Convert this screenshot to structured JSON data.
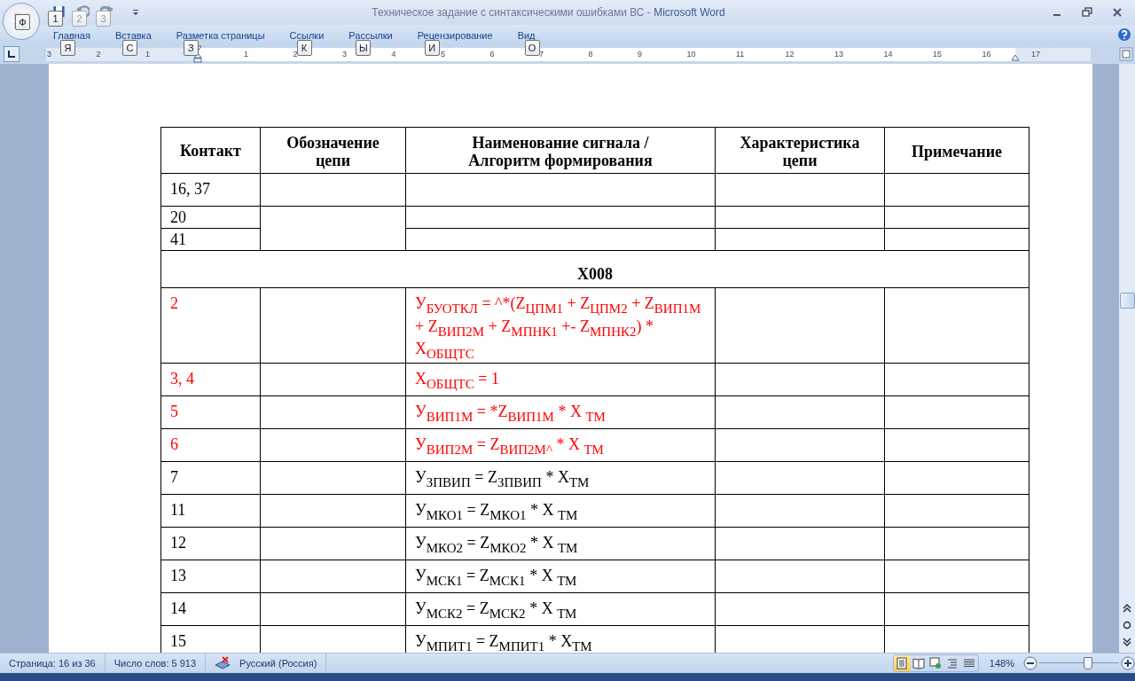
{
  "window": {
    "document": "Техническое задание с синтаксическими ошибками ВС",
    "separator": "-",
    "app": "Microsoft Word"
  },
  "office_button": {
    "keytip": "Ф"
  },
  "quick_access": [
    {
      "kind": "save",
      "keytip": "1",
      "disabled": false
    },
    {
      "kind": "undo",
      "keytip": "2",
      "disabled": true
    },
    {
      "kind": "redo",
      "keytip": "3",
      "disabled": true
    }
  ],
  "tabs": [
    {
      "label": "Главная",
      "keytip": "Я",
      "selected": false
    },
    {
      "label": "Вставка",
      "keytip": "С",
      "selected": false
    },
    {
      "label": "Разметка страницы",
      "keytip": "З",
      "selected": false
    },
    {
      "label": "Ссылки",
      "keytip": "К",
      "selected": false
    },
    {
      "label": "Рассылки",
      "keytip": "Ы",
      "selected": false
    },
    {
      "label": "Рецензирование",
      "keytip": "И",
      "selected": false
    },
    {
      "label": "Вид",
      "keytip": "О",
      "selected": false
    }
  ],
  "ruler": {
    "left_numbers": [
      "3",
      "2",
      "1"
    ],
    "right_numbers": [
      "1",
      "2",
      "3",
      "4",
      "5",
      "6",
      "7",
      "8",
      "9",
      "10",
      "11",
      "12",
      "13",
      "14",
      "15",
      "16",
      "17"
    ]
  },
  "table": {
    "columns": [
      "Контакт",
      "Обозначение цепи",
      "Наименование сигнала / Алгоритм формирования",
      "Характеристика цепи",
      "Примечание"
    ],
    "rows": [
      {
        "kind": "data",
        "contact": "16, 37",
        "error": false
      },
      {
        "kind": "merge-top",
        "contact": "20",
        "error": false
      },
      {
        "kind": "merge-bottom",
        "contact": "41",
        "error": false
      },
      {
        "kind": "section",
        "title": "X008"
      },
      {
        "kind": "data",
        "contact": "2",
        "signal": "У$_{БУОТКЛ}$ = ^*(Z$_{ЦПМ1}$ + Z$_{ЦПМ2}$ + Z$_{ВИП1М}$ + Z$_{ВИП2М}$ + Z$_{МПНК1}$ +- Z$_{МПНК2}$) * X$_{ОБЩТС}$",
        "error": true
      },
      {
        "kind": "data",
        "contact": "3, 4",
        "signal": "X$_{ОБЩТС}$ = 1",
        "error": true
      },
      {
        "kind": "data",
        "contact": "5",
        "signal": "У$_{ВИП1М}$ = *Z$_{ВИП1М}$ * X $_{ТМ}$",
        "error": true
      },
      {
        "kind": "data",
        "contact": "6",
        "signal": "У$_{ВИП2М}$ = Z$_{ВИП2М^}$ * X $_{ТМ}$",
        "error": true
      },
      {
        "kind": "data",
        "contact": "7",
        "signal": "У$_{ЗПВИП}$ = Z$_{ЗПВИП}$ * X$_{ТМ}$",
        "error": false
      },
      {
        "kind": "data",
        "contact": "11",
        "signal": "У$_{МКО1}$ = Z$_{МКО1}$ * X $_{ТМ}$",
        "error": false
      },
      {
        "kind": "data",
        "contact": "12",
        "signal": "У$_{МКО2}$ = Z$_{МКО2}$ * X $_{ТМ}$",
        "error": false
      },
      {
        "kind": "data",
        "contact": "13",
        "signal": "У$_{МСК1}$ = Z$_{МСК1}$ * X $_{ТМ}$",
        "error": false
      },
      {
        "kind": "data",
        "contact": "14",
        "signal": "У$_{МСК2}$ = Z$_{МСК2}$ * X $_{ТМ}$",
        "error": false
      },
      {
        "kind": "data",
        "contact": "15",
        "signal": "У$_{МПИТ1}$ = Z$_{МПИТ1}$ * X$_{ТМ}$",
        "error": false
      }
    ]
  },
  "status_bar": {
    "page": "Страница: 16 из 36",
    "words": "Число слов: 5 913",
    "language": "Русский (Россия)",
    "views": [
      {
        "kind": "print",
        "selected": true
      },
      {
        "kind": "reading",
        "selected": false
      },
      {
        "kind": "web",
        "selected": false
      },
      {
        "kind": "outline",
        "selected": false
      },
      {
        "kind": "draft",
        "selected": false
      }
    ],
    "zoom": {
      "label": "148%",
      "level": 0.6
    }
  }
}
